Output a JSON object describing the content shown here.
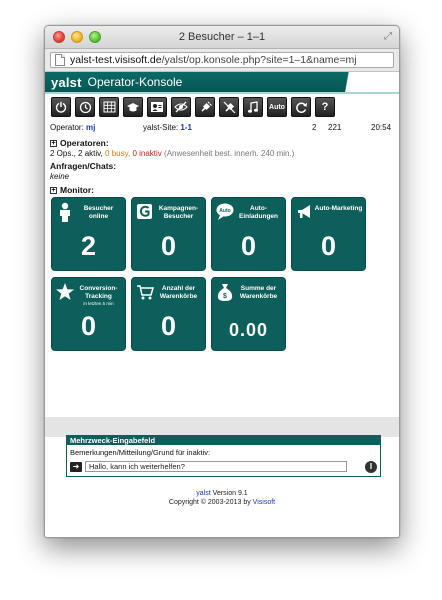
{
  "window": {
    "title": "2 Besucher – 1–1",
    "url_host": "yalst-test.visisoft.de",
    "url_path": "/yalst/op.konsole.php?site=1–1&name=mj"
  },
  "brand": {
    "logo": "yalst",
    "title": "Operator-Konsole",
    "accent_color": "#0d5f5b"
  },
  "toolbar": {
    "buttons": [
      {
        "icon": "power-icon"
      },
      {
        "icon": "clock-icon"
      },
      {
        "icon": "grid-icon"
      },
      {
        "icon": "graduation-cap-icon"
      },
      {
        "icon": "user-card-icon"
      },
      {
        "icon": "eye-crossed-icon"
      },
      {
        "icon": "plug-icon"
      },
      {
        "icon": "plug-off-icon"
      },
      {
        "icon": "music-note-icon"
      },
      {
        "icon": "auto-icon",
        "label": "Auto"
      },
      {
        "icon": "refresh-icon"
      },
      {
        "icon": "help-icon",
        "label": "?"
      }
    ]
  },
  "status": {
    "operator_label": "Operator:",
    "operator_value": "mj",
    "site_label": "yalst-Site:",
    "site_value": "1-1",
    "count1": "2",
    "count2": "221",
    "time": "20:54"
  },
  "operators": {
    "heading": "Operatoren:",
    "ops": "2 Ops.,",
    "active": "2 aktiv,",
    "busy": "0 busy,",
    "inactive": "0 inaktiv",
    "note": "(Anwesenheit best. innerh. 240 min.)"
  },
  "requests": {
    "heading": "Anfragen/Chats:",
    "value": "keine"
  },
  "monitor": {
    "heading": "Monitor:",
    "tiles": [
      {
        "icon": "person-icon",
        "label": "Besucher online",
        "value": "2"
      },
      {
        "icon": "g-campaign-icon",
        "label": "Kampagnen-Besucher",
        "value": "0"
      },
      {
        "icon": "auto-invite-icon",
        "label": "Auto-Einladungen",
        "value": "0"
      },
      {
        "icon": "megaphone-icon",
        "label": "Auto-Marketing",
        "value": "0"
      },
      {
        "icon": "star-icon",
        "label": "Conversion-Tracking",
        "sublabel": "in letzten 5 min",
        "value": "0"
      },
      {
        "icon": "cart-icon",
        "label": "Anzahl der Warenkörbe",
        "value": "0"
      },
      {
        "icon": "money-bag-icon",
        "label": "Summe der Warenkörbe",
        "value": "0.00"
      }
    ]
  },
  "multi": {
    "heading": "Mehrzweck-Eingabefeld",
    "label": "Bemerkungen/Mitteilung/Grund für inaktiv:",
    "input_value": "Hallo, kann ich weiterhelfen?"
  },
  "footer": {
    "product": "yalst",
    "version": "Version 9.1",
    "copyright": "Copyright © 2003-2013 by",
    "company": "Visisoft"
  }
}
